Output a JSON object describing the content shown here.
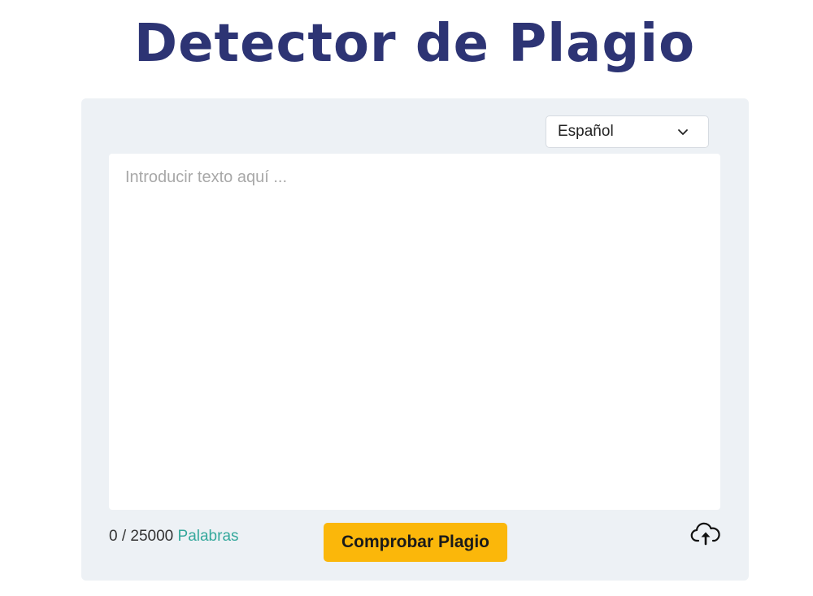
{
  "header": {
    "title": "Detector de Plagio"
  },
  "language": {
    "selected": "Español",
    "icon": "chevron-down-icon"
  },
  "editor": {
    "placeholder": "Introducir texto aquí ...",
    "value": ""
  },
  "counter": {
    "count": "0 / 25000",
    "unit": "Palabras"
  },
  "actions": {
    "check_label": "Comprobar Plagio",
    "upload_icon": "cloud-upload-icon"
  },
  "colors": {
    "title": "#2d3474",
    "panel_bg": "#edf1f5",
    "button_bg": "#fbb70a",
    "counter_unit": "#35a89c"
  }
}
